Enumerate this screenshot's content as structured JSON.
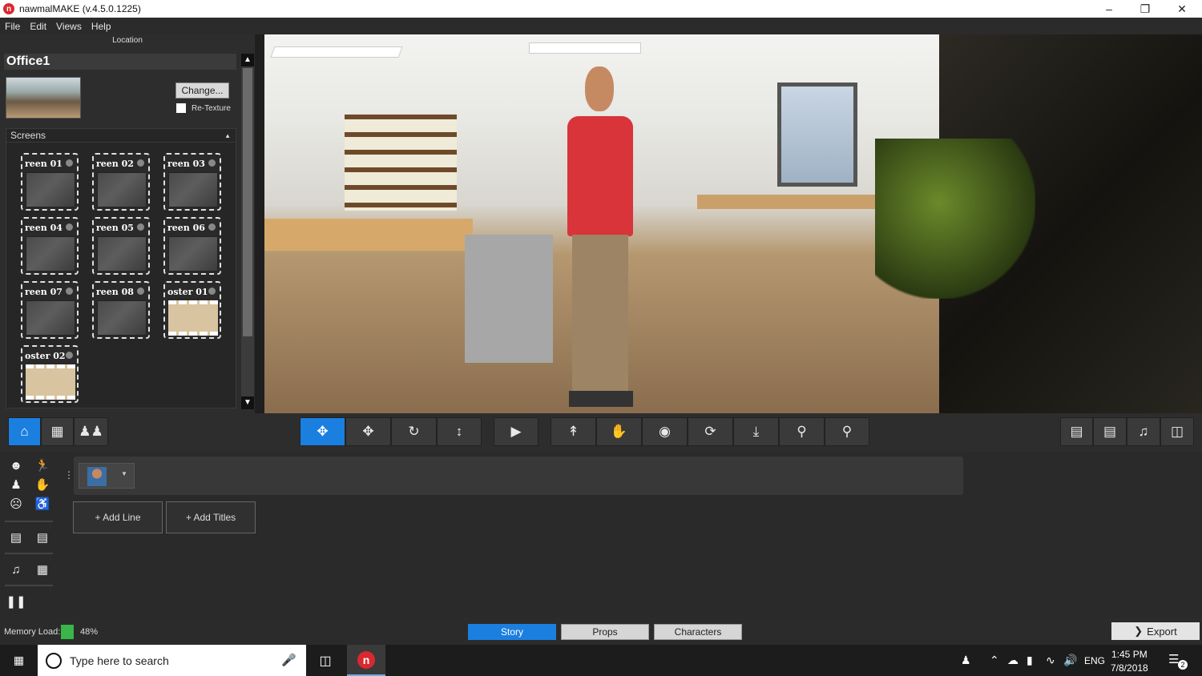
{
  "window": {
    "title": "nawmalMAKE (v.4.5.0.1225)",
    "logo_letter": "n"
  },
  "menu": [
    "File",
    "Edit",
    "Views",
    "Help"
  ],
  "location": {
    "section_label": "Location",
    "name": "Office1",
    "change_label": "Change...",
    "retexture_label": "Re-Texture"
  },
  "screens": {
    "header": "Screens",
    "items": [
      {
        "label": "reen 01",
        "kind": "screen"
      },
      {
        "label": "reen 02",
        "kind": "screen"
      },
      {
        "label": "reen 03",
        "kind": "screen"
      },
      {
        "label": "reen 04",
        "kind": "screen"
      },
      {
        "label": "reen 05",
        "kind": "screen"
      },
      {
        "label": "reen 06",
        "kind": "screen"
      },
      {
        "label": "reen 07",
        "kind": "screen"
      },
      {
        "label": "reen 08",
        "kind": "screen"
      },
      {
        "label": "oster 01",
        "kind": "poster"
      },
      {
        "label": "oster 02",
        "kind": "poster"
      }
    ]
  },
  "toolbar": {
    "left_icons": [
      "home-icon",
      "location-icon",
      "characters-icon"
    ],
    "center_icons": [
      "select-move-icon",
      "move-icon",
      "rotate-icon",
      "height-icon",
      "play-icon",
      "pose-icon",
      "hand-icon",
      "eye-icon",
      "refresh-icon",
      "ground-icon",
      "zoom-icon",
      "zoom-fit-icon"
    ],
    "right_icons": [
      "camera-icon",
      "video-camera-icon",
      "music-icon",
      "screen-switch-icon"
    ],
    "active": [
      "home-icon",
      "select-move-icon"
    ]
  },
  "timeline": {
    "add_line_label": "+ Add Line",
    "add_titles_label": "+ Add Titles"
  },
  "status": {
    "memory_label": "Memory Load:",
    "memory_value": "48%",
    "memory_color": "#39b54a",
    "tabs": [
      "Story",
      "Props",
      "Characters"
    ],
    "active_tab": "Story",
    "export_label": "Export"
  },
  "taskbar": {
    "search_placeholder": "Type here to search",
    "language": "ENG",
    "time": "1:45 PM",
    "date": "7/8/2018",
    "notification_count": "2"
  },
  "colors": {
    "accent": "#1b7fe0",
    "brand": "#d9292f"
  }
}
